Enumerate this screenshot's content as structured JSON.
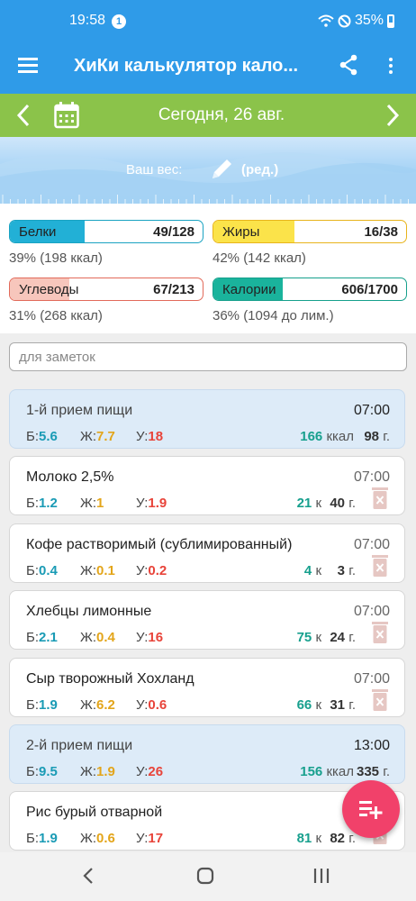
{
  "status": {
    "time": "19:58",
    "notifications": "1",
    "battery": "35%"
  },
  "appbar": {
    "title": "ХиКи калькулятор кало..."
  },
  "datebar": {
    "date": "Сегодня, 26 авг."
  },
  "weight": {
    "label": "Ваш вес:",
    "edit": "(ред.)"
  },
  "summary": {
    "protein": {
      "name": "Белки",
      "value": "49/128",
      "percent": "39% (198 ккал)",
      "fill": 0.39,
      "color": "#1aa3c2",
      "fillColor": "#22b0d6"
    },
    "fat": {
      "name": "Жиры",
      "value": "16/38",
      "percent": "42% (142 ккал)",
      "fill": 0.42,
      "color": "#e8b41c",
      "fillColor": "#fbe34a"
    },
    "carbs": {
      "name": "Углеводы",
      "value": "67/213",
      "percent": "31% (268 ккал)",
      "fill": 0.31,
      "color": "#e26a5a",
      "fillColor": "#f7c6bc"
    },
    "calories": {
      "name": "Калории",
      "value": "606/1700",
      "percent": "36% (1094 до лим.)",
      "fill": 0.36,
      "color": "#16a08c",
      "fillColor": "#1ab39c"
    }
  },
  "notes": {
    "placeholder": "для заметок"
  },
  "labels": {
    "b": "Б:",
    "f": "Ж:",
    "c": "У:",
    "kcal_long": "ккал",
    "kcal_short": "к",
    "grams": "г."
  },
  "entries": [
    {
      "type": "meal",
      "name": "1-й прием пищи",
      "time": "07:00",
      "b": "5.6",
      "f": "7.7",
      "c": "18",
      "kcal": "166",
      "grams": "98"
    },
    {
      "type": "food",
      "name": "Молоко 2,5%",
      "time": "07:00",
      "b": "1.2",
      "f": "1",
      "c": "1.9",
      "kcal": "21",
      "grams": "40"
    },
    {
      "type": "food",
      "name": "Кофе растворимый (сублимированный)",
      "time": "07:00",
      "b": "0.4",
      "f": "0.1",
      "c": "0.2",
      "kcal": "4",
      "grams": "3"
    },
    {
      "type": "food",
      "name": "Хлебцы лимонные",
      "time": "07:00",
      "b": "2.1",
      "f": "0.4",
      "c": "16",
      "kcal": "75",
      "grams": "24"
    },
    {
      "type": "food",
      "name": "Сыр творожный Хохланд",
      "time": "07:00",
      "b": "1.9",
      "f": "6.2",
      "c": "0.6",
      "kcal": "66",
      "grams": "31"
    },
    {
      "type": "meal",
      "name": "2-й прием пищи",
      "time": "13:00",
      "b": "9.5",
      "f": "1.9",
      "c": "26",
      "kcal": "156",
      "grams": "335"
    },
    {
      "type": "food",
      "name": "Рис бурый отварной",
      "time": "",
      "b": "1.9",
      "f": "0.6",
      "c": "17",
      "kcal": "81",
      "grams": "82"
    }
  ]
}
